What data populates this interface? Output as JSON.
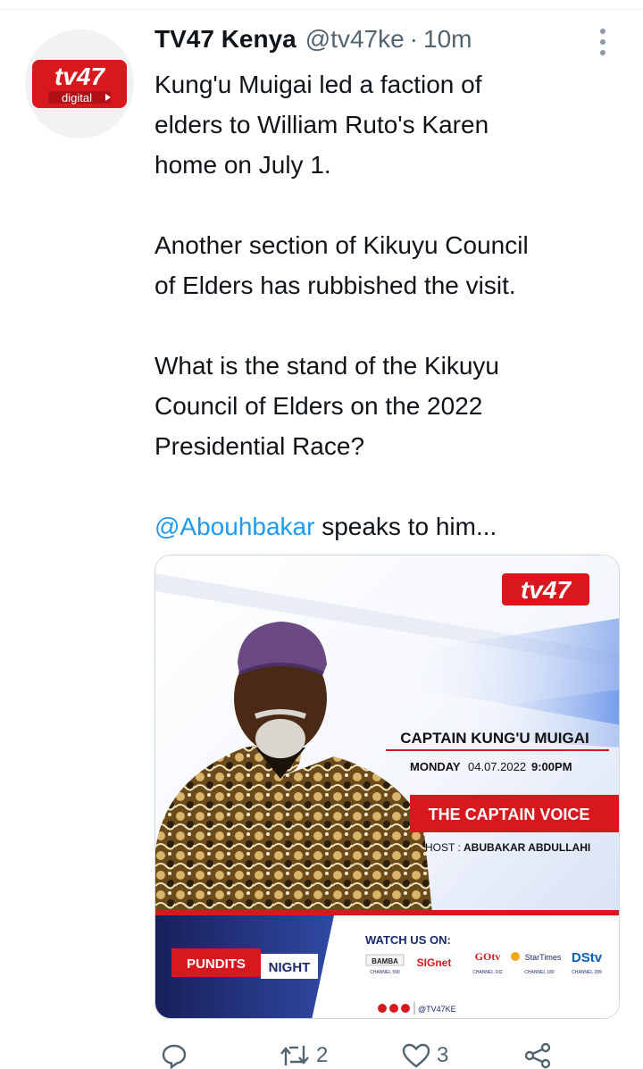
{
  "tweet": {
    "author_name": "TV47 Kenya",
    "author_handle": "@tv47ke",
    "separator": "·",
    "time": "10m",
    "paragraphs": [
      [
        "Kung'u Muigai led a faction of",
        "elders to William Ruto's Karen",
        "home on July 1."
      ],
      [
        "Another section of Kikuyu Council",
        "of Elders has rubbished the visit."
      ],
      [
        "What is the stand of the Kikuyu",
        "Council of Elders on the 2022",
        "Presidential Race?"
      ]
    ],
    "mention": "@Abouhbakar",
    "mention_suffix": " speaks to him..."
  },
  "avatar": {
    "logo_text": "tv47",
    "logo_sub": "digital"
  },
  "media": {
    "brand_logo": "tv47",
    "guest_name": "CAPTAIN KUNG'U MUIGAI",
    "day": "MONDAY",
    "date": "04.07.2022",
    "time": "9:00PM",
    "show_title": "THE CAPTAIN VOICE",
    "host_label": "HOST :",
    "host_name": "ABUBAKAR ABDULLAHI",
    "program_name_a": "PUNDITS",
    "program_name_b": "NIGHT",
    "watch_label": "WATCH US ON:",
    "channels": [
      {
        "name": "BAMBA",
        "channel": "CHANNEL 590"
      },
      {
        "name": "SIGnet",
        "channel": ""
      },
      {
        "name": "GOtv",
        "channel": "CHANNEL 102"
      },
      {
        "name": "StarTimes",
        "channel": "CHANNEL 180"
      },
      {
        "name": "DStv",
        "channel": "CHANNEL 289"
      }
    ],
    "social_handle": "@TV47KE"
  },
  "actions": {
    "reply_count": "",
    "retweet_count": "2",
    "like_count": "3"
  },
  "colors": {
    "brand_red": "#d7191f",
    "link_blue": "#1d9bf0",
    "muted_gray": "#536471",
    "navy": "#1b2a6b"
  }
}
